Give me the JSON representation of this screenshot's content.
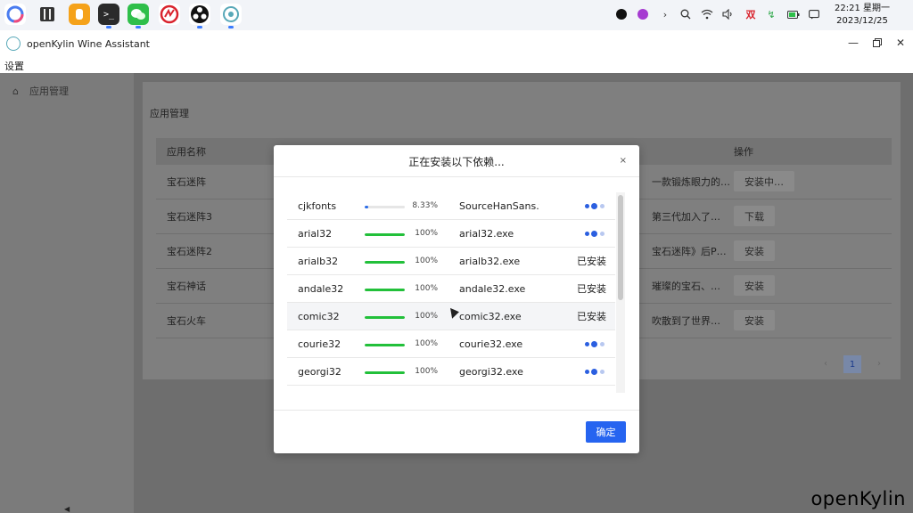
{
  "taskbar": {
    "apps": [
      {
        "name": "start-menu",
        "color": "#ffffff"
      },
      {
        "name": "file-manager",
        "color": "#ffffff"
      },
      {
        "name": "app-store",
        "color": "#f5a21a"
      },
      {
        "name": "terminal",
        "color": "#2b2b2b"
      },
      {
        "name": "wechat",
        "color": "#2fbf4a"
      },
      {
        "name": "wps",
        "color": "#ffffff"
      },
      {
        "name": "obs",
        "color": "#ffffff"
      },
      {
        "name": "wine-assistant",
        "color": "#ffffff"
      }
    ],
    "clock": {
      "time": "22:21 星期一",
      "date": "2023/12/25"
    },
    "tray_labels": {
      "input_method": "双"
    }
  },
  "window": {
    "title": "openKylin Wine Assistant",
    "menu": "设置"
  },
  "sidebar": {
    "items": [
      {
        "label": "应用管理"
      }
    ]
  },
  "main": {
    "title": "应用管理",
    "columns": {
      "name": "应用名称",
      "action": "操作"
    },
    "rows": [
      {
        "name": "宝石迷阵",
        "desc": "一款锻炼眼力的…",
        "action": "安装中…"
      },
      {
        "name": "宝石迷阵3",
        "desc": "第三代加入了…",
        "action": "下载"
      },
      {
        "name": "宝石迷阵2",
        "desc": "宝石迷阵》后P…",
        "action": "安装"
      },
      {
        "name": "宝石神话",
        "desc": "璀璨的宝石、…",
        "action": "安装"
      },
      {
        "name": "宝石火车",
        "desc": "吹散到了世界…",
        "action": "安装"
      }
    ],
    "page": "1"
  },
  "modal": {
    "title": "正在安装以下依赖...",
    "close": "×",
    "confirm": "确定",
    "items": [
      {
        "name": "cjkfonts",
        "progress": 8.33,
        "percent": "8.33%",
        "file": "SourceHanSans.ttf",
        "status": ""
      },
      {
        "name": "arial32",
        "progress": 100,
        "percent": "100%",
        "file": "arial32.exe",
        "status": ""
      },
      {
        "name": "arialb32",
        "progress": 100,
        "percent": "100%",
        "file": "arialb32.exe",
        "status": "已安装"
      },
      {
        "name": "andale32",
        "progress": 100,
        "percent": "100%",
        "file": "andale32.exe",
        "status": "已安装"
      },
      {
        "name": "comic32",
        "progress": 100,
        "percent": "100%",
        "file": "comic32.exe",
        "status": "已安装"
      },
      {
        "name": "courie32",
        "progress": 100,
        "percent": "100%",
        "file": "courie32.exe",
        "status": ""
      },
      {
        "name": "georgi32",
        "progress": 100,
        "percent": "100%",
        "file": "georgi32.exe",
        "status": ""
      }
    ],
    "progress_color_active": "#2b6de8",
    "progress_color_done": "#22c03a"
  },
  "watermark": "openKylin"
}
